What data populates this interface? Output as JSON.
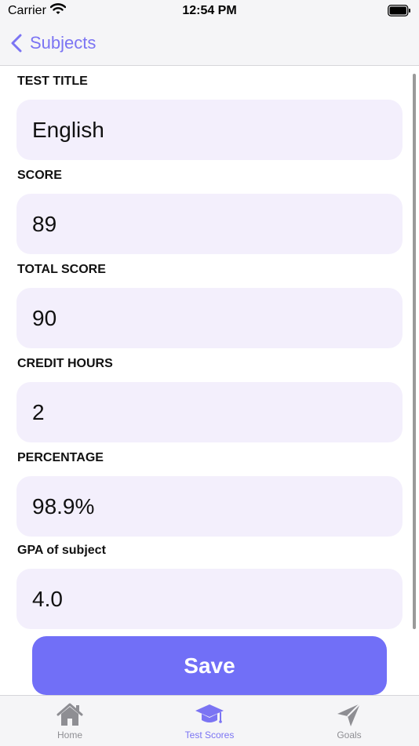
{
  "status_bar": {
    "carrier": "Carrier",
    "time": "12:54 PM"
  },
  "nav": {
    "back_label": "Subjects"
  },
  "fields": [
    {
      "label": "TEST TITLE",
      "value": "English"
    },
    {
      "label": "SCORE",
      "value": "89"
    },
    {
      "label": "TOTAL SCORE",
      "value": "90"
    },
    {
      "label": "CREDIT HOURS",
      "value": "2"
    },
    {
      "label": "PERCENTAGE",
      "value": "98.9%"
    },
    {
      "label": "GPA of subject",
      "value": "4.0"
    }
  ],
  "save_label": "Save",
  "tabs": [
    {
      "label": "Home",
      "icon": "home-icon"
    },
    {
      "label": "Test Scores",
      "icon": "graduation-cap-icon",
      "active": true
    },
    {
      "label": "Goals",
      "icon": "paper-plane-icon"
    }
  ],
  "colors": {
    "accent": "#7b74f3",
    "button": "#716ff7",
    "field_bg": "#f3effc"
  }
}
